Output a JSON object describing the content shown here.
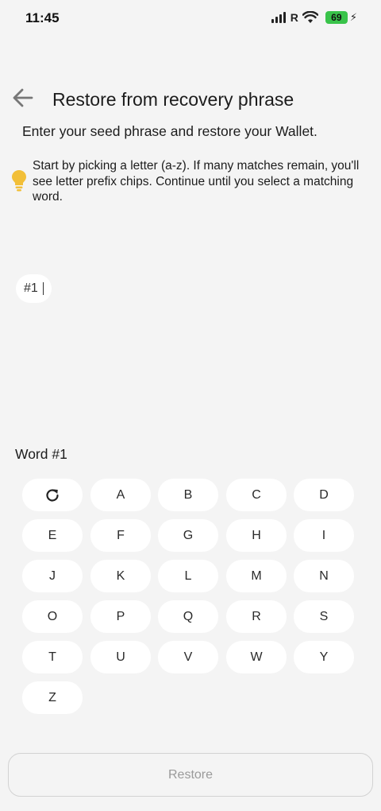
{
  "status_bar": {
    "time": "11:45",
    "roaming": "R",
    "battery": "69"
  },
  "header": {
    "title": "Restore from recovery phrase",
    "back_icon": "arrow-left-icon"
  },
  "subtitle": "Enter your seed phrase and restore your Wallet.",
  "tip": {
    "icon": "lightbulb-icon",
    "text": "Start by picking a letter (a-z). If many matches remain, you'll see letter prefix chips. Continue until you select a matching word.",
    "icon_color": "#f2bf38"
  },
  "word_chip": {
    "label": "#1"
  },
  "word_label": "Word #1",
  "keypad": {
    "reset_icon": "refresh-icon",
    "letters": [
      "A",
      "B",
      "C",
      "D",
      "E",
      "F",
      "G",
      "H",
      "I",
      "J",
      "K",
      "L",
      "M",
      "N",
      "O",
      "P",
      "Q",
      "R",
      "S",
      "T",
      "U",
      "V",
      "W",
      "Y",
      "Z"
    ]
  },
  "restore_button": {
    "label": "Restore",
    "enabled": false
  }
}
